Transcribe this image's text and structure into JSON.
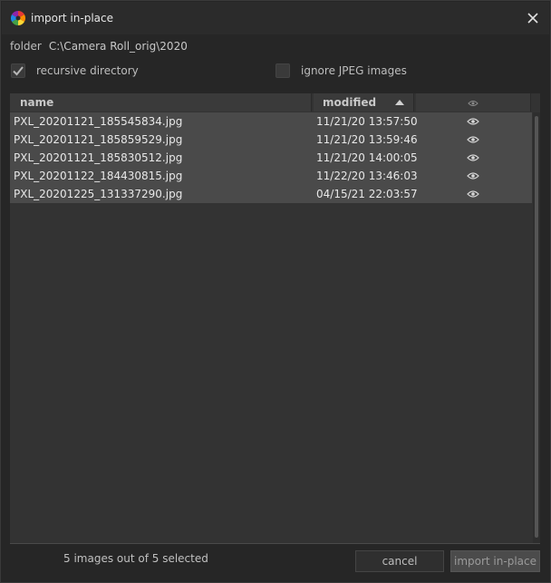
{
  "window": {
    "title": "import in-place"
  },
  "folder": {
    "label": "folder",
    "path": "C:\\Camera Roll_orig\\2020"
  },
  "options": {
    "recursive": {
      "label": "recursive directory",
      "checked": true
    },
    "ignore_jpeg": {
      "label": "ignore JPEG images",
      "checked": false
    }
  },
  "table": {
    "columns": {
      "name": "name",
      "modified": "modified"
    },
    "sort": {
      "column": "modified",
      "direction": "ascending"
    },
    "rows": [
      {
        "name": "PXL_20201121_185545834.jpg",
        "modified": "11/21/20 13:57:50"
      },
      {
        "name": "PXL_20201121_185859529.jpg",
        "modified": "11/21/20 13:59:46"
      },
      {
        "name": "PXL_20201121_185830512.jpg",
        "modified": "11/21/20 14:00:05"
      },
      {
        "name": "PXL_20201122_184430815.jpg",
        "modified": "11/22/20 13:46:03"
      },
      {
        "name": "PXL_20201225_131337290.jpg",
        "modified": "04/15/21 22:03:57"
      }
    ]
  },
  "status": {
    "text": "5 images out of 5 selected"
  },
  "buttons": {
    "cancel": "cancel",
    "import": "import in-place"
  },
  "icons": {
    "logo": "darktable-logo-icon",
    "close": "close-icon",
    "thumbnail": "eye-icon",
    "check": "checkmark-icon",
    "sort": "sort-ascending-icon"
  },
  "colors": {
    "background": "#262626",
    "selected_row": "#4a4a4a",
    "header": "#3a3a3a"
  }
}
